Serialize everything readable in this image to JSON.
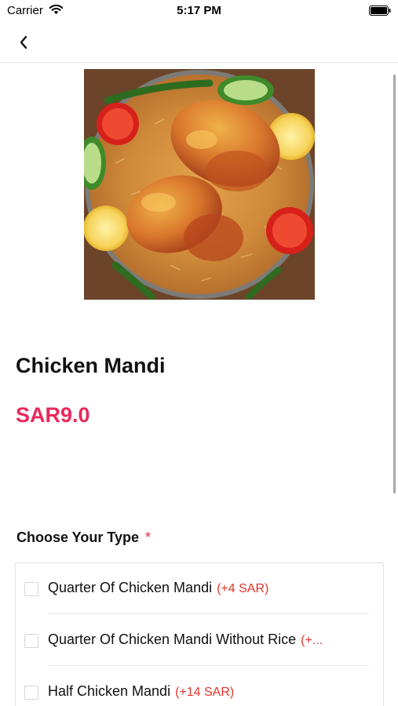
{
  "status_bar": {
    "carrier": "Carrier",
    "time": "5:17 PM"
  },
  "nav": {
    "back_icon": "chevron-left-icon"
  },
  "product": {
    "title": "Chicken Mandi",
    "price": "SAR9.0",
    "price_color": "#e9285b"
  },
  "options_section": {
    "heading": "Choose Your Type",
    "required_marker": "*",
    "items": [
      {
        "label": "Quarter Of Chicken Mandi",
        "extra": "(+4 SAR)"
      },
      {
        "label": "Quarter Of Chicken Mandi Without Rice",
        "extra": "(+..."
      },
      {
        "label": "Half Chicken Mandi",
        "extra": "(+14 SAR)"
      }
    ]
  }
}
